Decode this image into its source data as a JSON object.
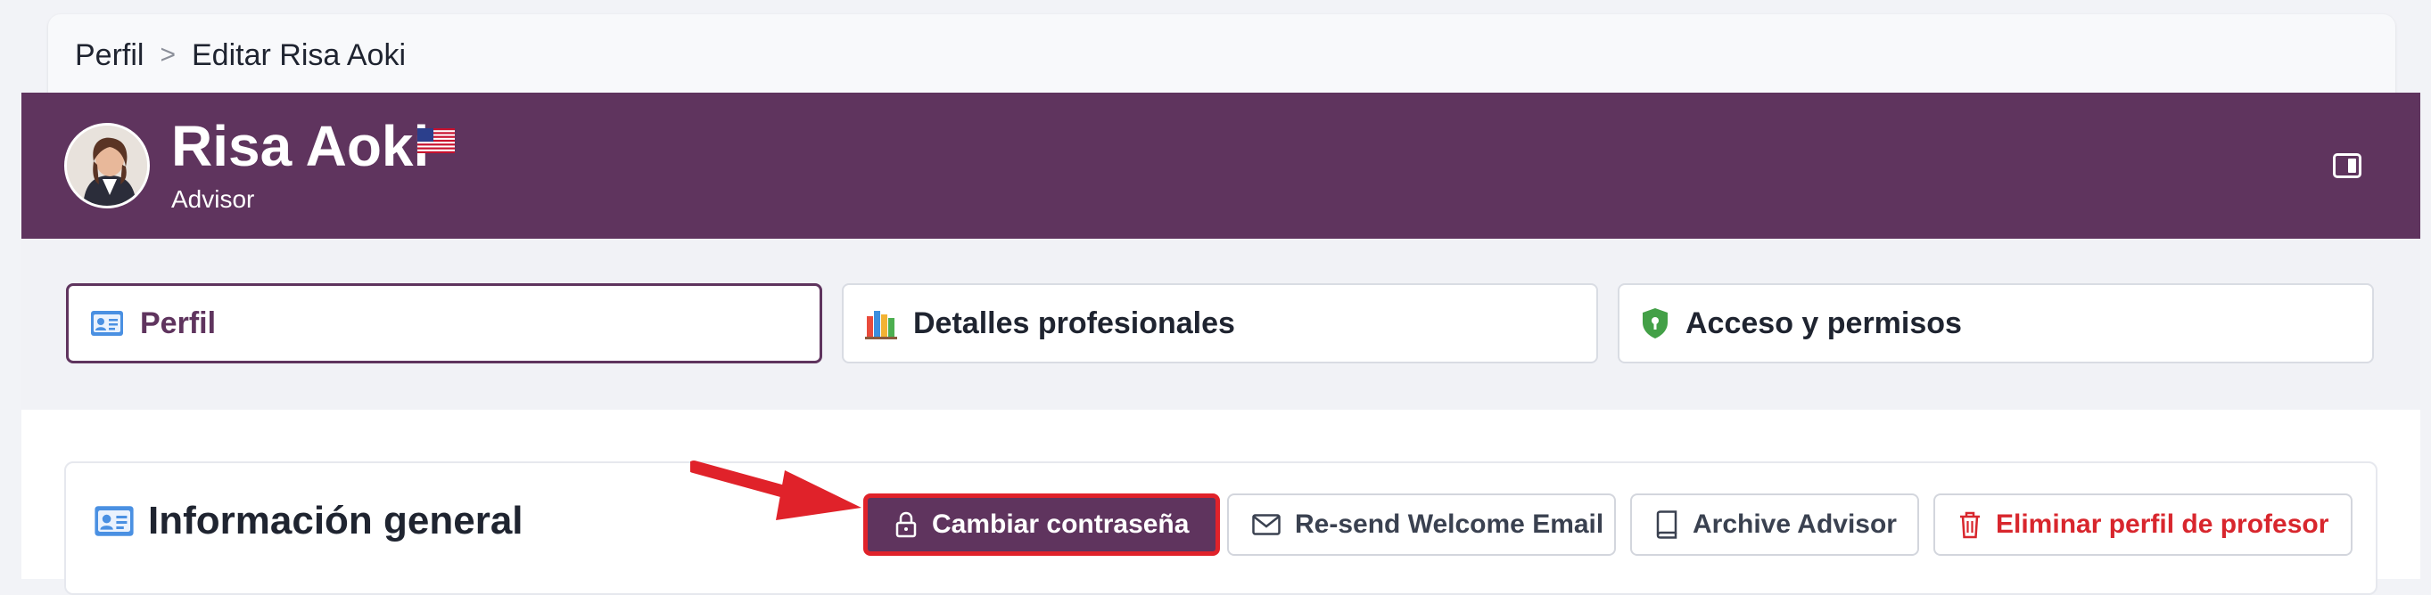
{
  "breadcrumb": {
    "items": [
      "Perfil",
      "Editar Risa Aoki"
    ],
    "separator": ">"
  },
  "header": {
    "name": "Risa Aoki",
    "role": "Advisor",
    "flag_icon": "us-flag-icon",
    "background_color": "#5f345e"
  },
  "tabs": [
    {
      "label": "Perfil",
      "icon": "id-card-icon",
      "active": true
    },
    {
      "label": "Detalles profesionales",
      "icon": "books-icon",
      "active": false
    },
    {
      "label": "Acceso y permisos",
      "icon": "shield-icon",
      "active": false
    }
  ],
  "section": {
    "title": "Información general",
    "icon": "id-card-icon"
  },
  "actions": {
    "change_password": "Cambiar contraseña",
    "resend_email": "Re-send Welcome Email",
    "archive": "Archive Advisor",
    "delete": "Eliminar perfil de profesor"
  },
  "colors": {
    "accent": "#5f345e",
    "danger": "#d8262d",
    "highlight": "#e0222a"
  }
}
